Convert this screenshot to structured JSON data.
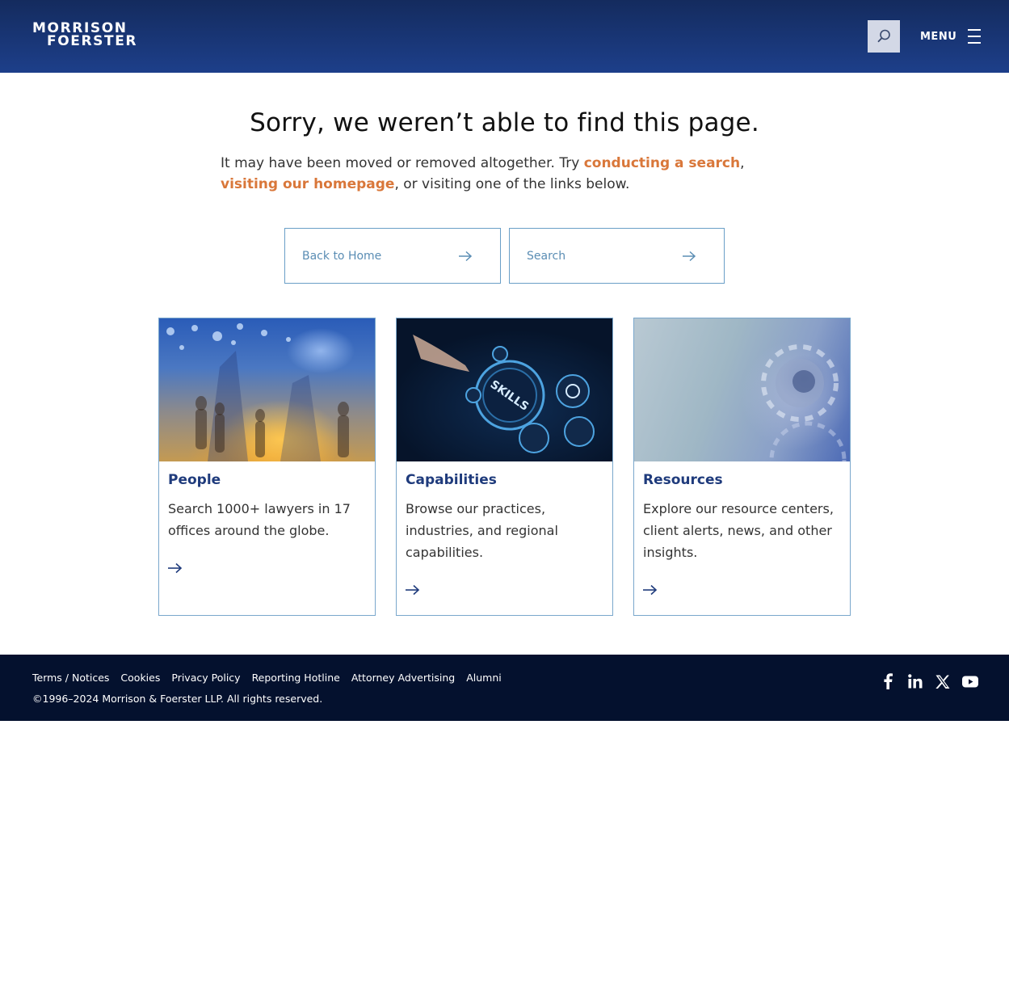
{
  "header": {
    "logo_line1": "MORRISON",
    "logo_line2": "FOERSTER",
    "menu_label": "MENU"
  },
  "main": {
    "title": "Sorry, we weren’t able to find this page.",
    "intro_before": "It may have been moved or removed altogether. Try ",
    "intro_link1": "conducting a search",
    "intro_sep": ", ",
    "intro_link2": "visiting our homepage",
    "intro_after": ", or visiting one of the links below."
  },
  "buttons": {
    "home": "Back to Home",
    "search": "Search"
  },
  "cards": [
    {
      "title": "People",
      "text": "Search 1000+ lawyers in 17 offices around the globe.",
      "image": "people-city-photo"
    },
    {
      "title": "Capabilities",
      "text": "Browse our practices, industries, and regional capabilities.",
      "image": "skills-button-photo"
    },
    {
      "title": "Resources",
      "text": "Explore our resource centers, client alerts, news, and other insights.",
      "image": "gears-photo"
    }
  ],
  "footer": {
    "links": [
      "Terms / Notices",
      "Cookies",
      "Privacy Policy",
      "Reporting Hotline",
      "Attorney Advertising",
      "Alumni"
    ],
    "copyright": "©1996–2024 Morrison & Foerster LLP. All rights reserved.",
    "social": [
      "facebook-icon",
      "linkedin-icon",
      "x-icon",
      "youtube-icon"
    ]
  },
  "colors": {
    "header": "#1d3f8a",
    "accent_link": "#d9773a",
    "card_title": "#1f3b7c",
    "footer": "#04112e"
  }
}
